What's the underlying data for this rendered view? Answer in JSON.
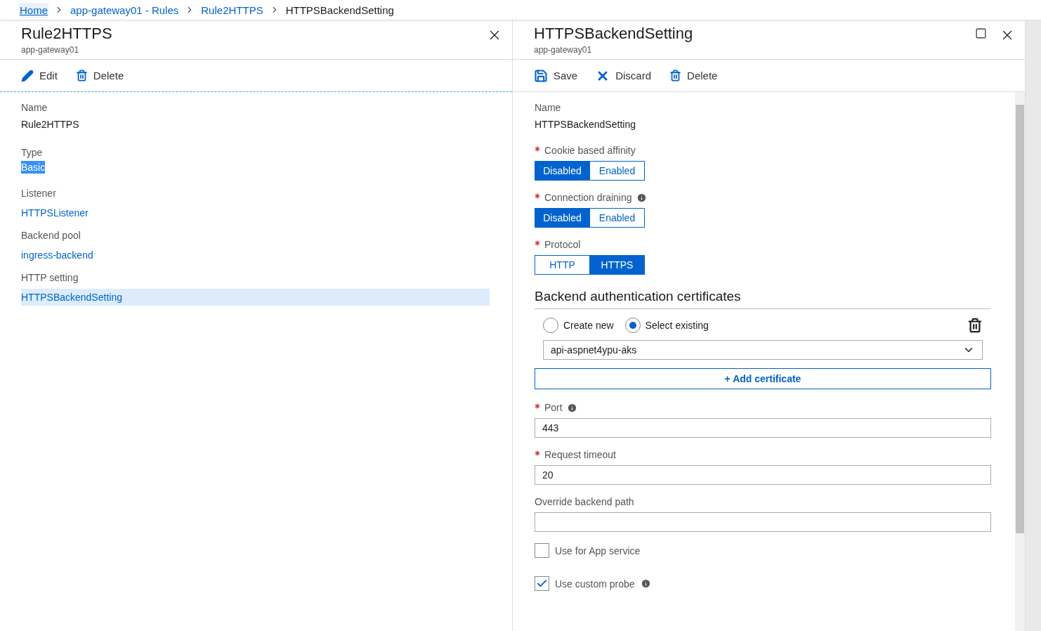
{
  "breadcrumb": [
    {
      "label": "Home",
      "kind": "home"
    },
    {
      "label": "app-gateway01 - Rules",
      "kind": "link"
    },
    {
      "label": "Rule2HTTPS",
      "kind": "link"
    },
    {
      "label": "HTTPSBackendSetting",
      "kind": "current"
    }
  ],
  "left_blade": {
    "title": "Rule2HTTPS",
    "subtitle": "app-gateway01",
    "toolbar": [
      {
        "label": "Edit"
      },
      {
        "label": "Delete"
      }
    ],
    "fields": [
      {
        "label": "Name",
        "value": "Rule2HTTPS",
        "kind": "text"
      },
      {
        "label": "Type",
        "value": "Basic",
        "kind": "marked"
      },
      {
        "label": "Listener",
        "value": "HTTPSListener",
        "kind": "link",
        "selected": false
      },
      {
        "label": "Backend pool",
        "value": "ingress-backend",
        "kind": "link",
        "selected": false
      },
      {
        "label": "HTTP setting",
        "value": "HTTPSBackendSetting",
        "kind": "link",
        "selected": true
      }
    ]
  },
  "right_blade": {
    "title": "HTTPSBackendSetting",
    "subtitle": "app-gateway01",
    "toolbar": [
      {
        "label": "Save"
      },
      {
        "label": "Discard"
      },
      {
        "label": "Delete"
      }
    ],
    "fields": [
      {
        "kind": "text",
        "label": "Name",
        "value": "HTTPSBackendSetting"
      },
      {
        "kind": "toggle",
        "label": "Cookie based affinity",
        "required": true,
        "info": false,
        "options": [
          {
            "label": "Disabled",
            "selected": true
          },
          {
            "label": "Enabled",
            "selected": false
          }
        ]
      },
      {
        "kind": "toggle",
        "label": "Connection draining",
        "required": true,
        "info": true,
        "options": [
          {
            "label": "Disabled",
            "selected": true
          },
          {
            "label": "Enabled",
            "selected": false
          }
        ]
      },
      {
        "kind": "toggle",
        "label": "Protocol",
        "required": true,
        "info": false,
        "options": [
          {
            "label": "HTTP",
            "selected": false
          },
          {
            "label": "HTTPS",
            "selected": true
          }
        ]
      },
      {
        "kind": "section",
        "title": "Backend authentication certificates"
      },
      {
        "kind": "radio",
        "options": [
          {
            "label": "Create new",
            "selected": false
          },
          {
            "label": "Select existing",
            "selected": true
          }
        ]
      },
      {
        "kind": "dropdown",
        "value": "api-aspnet4ypu-aks"
      },
      {
        "kind": "button",
        "label": "+ Add certificate"
      },
      {
        "kind": "input",
        "label": "Port",
        "required": true,
        "info": true,
        "value": "443"
      },
      {
        "kind": "input",
        "label": "Request timeout",
        "required": true,
        "info": false,
        "value": "20"
      },
      {
        "kind": "input",
        "label": "Override backend path",
        "required": false,
        "info": false
      },
      {
        "kind": "checkbox",
        "label": "Use for App service",
        "checked": false,
        "info": false
      },
      {
        "kind": "checkbox",
        "label": "Use custom probe",
        "checked": true,
        "info": true
      }
    ]
  }
}
